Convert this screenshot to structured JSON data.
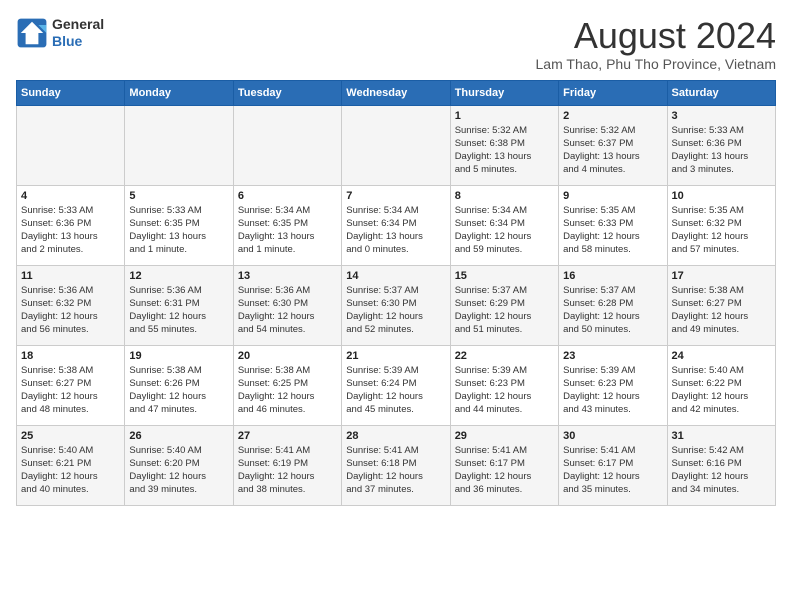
{
  "logo": {
    "line1": "General",
    "line2": "Blue"
  },
  "title": "August 2024",
  "subtitle": "Lam Thao, Phu Tho Province, Vietnam",
  "headers": [
    "Sunday",
    "Monday",
    "Tuesday",
    "Wednesday",
    "Thursday",
    "Friday",
    "Saturday"
  ],
  "weeks": [
    [
      {
        "day": "",
        "info": ""
      },
      {
        "day": "",
        "info": ""
      },
      {
        "day": "",
        "info": ""
      },
      {
        "day": "",
        "info": ""
      },
      {
        "day": "1",
        "info": "Sunrise: 5:32 AM\nSunset: 6:38 PM\nDaylight: 13 hours\nand 5 minutes."
      },
      {
        "day": "2",
        "info": "Sunrise: 5:32 AM\nSunset: 6:37 PM\nDaylight: 13 hours\nand 4 minutes."
      },
      {
        "day": "3",
        "info": "Sunrise: 5:33 AM\nSunset: 6:36 PM\nDaylight: 13 hours\nand 3 minutes."
      }
    ],
    [
      {
        "day": "4",
        "info": "Sunrise: 5:33 AM\nSunset: 6:36 PM\nDaylight: 13 hours\nand 2 minutes."
      },
      {
        "day": "5",
        "info": "Sunrise: 5:33 AM\nSunset: 6:35 PM\nDaylight: 13 hours\nand 1 minute."
      },
      {
        "day": "6",
        "info": "Sunrise: 5:34 AM\nSunset: 6:35 PM\nDaylight: 13 hours\nand 1 minute."
      },
      {
        "day": "7",
        "info": "Sunrise: 5:34 AM\nSunset: 6:34 PM\nDaylight: 13 hours\nand 0 minutes."
      },
      {
        "day": "8",
        "info": "Sunrise: 5:34 AM\nSunset: 6:34 PM\nDaylight: 12 hours\nand 59 minutes."
      },
      {
        "day": "9",
        "info": "Sunrise: 5:35 AM\nSunset: 6:33 PM\nDaylight: 12 hours\nand 58 minutes."
      },
      {
        "day": "10",
        "info": "Sunrise: 5:35 AM\nSunset: 6:32 PM\nDaylight: 12 hours\nand 57 minutes."
      }
    ],
    [
      {
        "day": "11",
        "info": "Sunrise: 5:36 AM\nSunset: 6:32 PM\nDaylight: 12 hours\nand 56 minutes."
      },
      {
        "day": "12",
        "info": "Sunrise: 5:36 AM\nSunset: 6:31 PM\nDaylight: 12 hours\nand 55 minutes."
      },
      {
        "day": "13",
        "info": "Sunrise: 5:36 AM\nSunset: 6:30 PM\nDaylight: 12 hours\nand 54 minutes."
      },
      {
        "day": "14",
        "info": "Sunrise: 5:37 AM\nSunset: 6:30 PM\nDaylight: 12 hours\nand 52 minutes."
      },
      {
        "day": "15",
        "info": "Sunrise: 5:37 AM\nSunset: 6:29 PM\nDaylight: 12 hours\nand 51 minutes."
      },
      {
        "day": "16",
        "info": "Sunrise: 5:37 AM\nSunset: 6:28 PM\nDaylight: 12 hours\nand 50 minutes."
      },
      {
        "day": "17",
        "info": "Sunrise: 5:38 AM\nSunset: 6:27 PM\nDaylight: 12 hours\nand 49 minutes."
      }
    ],
    [
      {
        "day": "18",
        "info": "Sunrise: 5:38 AM\nSunset: 6:27 PM\nDaylight: 12 hours\nand 48 minutes."
      },
      {
        "day": "19",
        "info": "Sunrise: 5:38 AM\nSunset: 6:26 PM\nDaylight: 12 hours\nand 47 minutes."
      },
      {
        "day": "20",
        "info": "Sunrise: 5:38 AM\nSunset: 6:25 PM\nDaylight: 12 hours\nand 46 minutes."
      },
      {
        "day": "21",
        "info": "Sunrise: 5:39 AM\nSunset: 6:24 PM\nDaylight: 12 hours\nand 45 minutes."
      },
      {
        "day": "22",
        "info": "Sunrise: 5:39 AM\nSunset: 6:23 PM\nDaylight: 12 hours\nand 44 minutes."
      },
      {
        "day": "23",
        "info": "Sunrise: 5:39 AM\nSunset: 6:23 PM\nDaylight: 12 hours\nand 43 minutes."
      },
      {
        "day": "24",
        "info": "Sunrise: 5:40 AM\nSunset: 6:22 PM\nDaylight: 12 hours\nand 42 minutes."
      }
    ],
    [
      {
        "day": "25",
        "info": "Sunrise: 5:40 AM\nSunset: 6:21 PM\nDaylight: 12 hours\nand 40 minutes."
      },
      {
        "day": "26",
        "info": "Sunrise: 5:40 AM\nSunset: 6:20 PM\nDaylight: 12 hours\nand 39 minutes."
      },
      {
        "day": "27",
        "info": "Sunrise: 5:41 AM\nSunset: 6:19 PM\nDaylight: 12 hours\nand 38 minutes."
      },
      {
        "day": "28",
        "info": "Sunrise: 5:41 AM\nSunset: 6:18 PM\nDaylight: 12 hours\nand 37 minutes."
      },
      {
        "day": "29",
        "info": "Sunrise: 5:41 AM\nSunset: 6:17 PM\nDaylight: 12 hours\nand 36 minutes."
      },
      {
        "day": "30",
        "info": "Sunrise: 5:41 AM\nSunset: 6:17 PM\nDaylight: 12 hours\nand 35 minutes."
      },
      {
        "day": "31",
        "info": "Sunrise: 5:42 AM\nSunset: 6:16 PM\nDaylight: 12 hours\nand 34 minutes."
      }
    ]
  ]
}
